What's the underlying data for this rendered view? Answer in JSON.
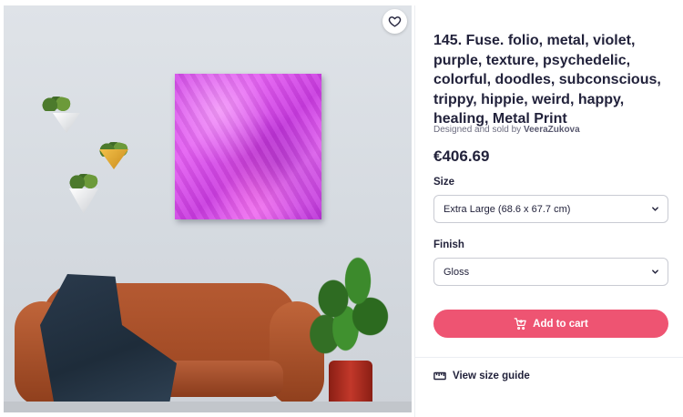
{
  "product": {
    "title": "145. Fuse. folio, metal, violet, purple, texture, psychedelic, colorful, doodles, subconscious, trippy, hippie, weird, happy, healing, Metal Print",
    "byline_prefix": "Designed and sold by",
    "artist": "VeeraZukova",
    "price": "€406.69"
  },
  "options": {
    "size_label": "Size",
    "size_value": "Extra Large (68.6 x 67.7 cm)",
    "finish_label": "Finish",
    "finish_value": "Gloss"
  },
  "actions": {
    "add_to_cart": "Add to cart",
    "size_guide": "View size guide"
  },
  "icons": {
    "favorite": "heart-outline-icon",
    "cart": "cart-icon",
    "chevron": "chevron-down-icon",
    "ruler": "ruler-icon"
  },
  "colors": {
    "accent": "#ee5472",
    "text": "#22223b",
    "muted": "#6d6d80"
  }
}
